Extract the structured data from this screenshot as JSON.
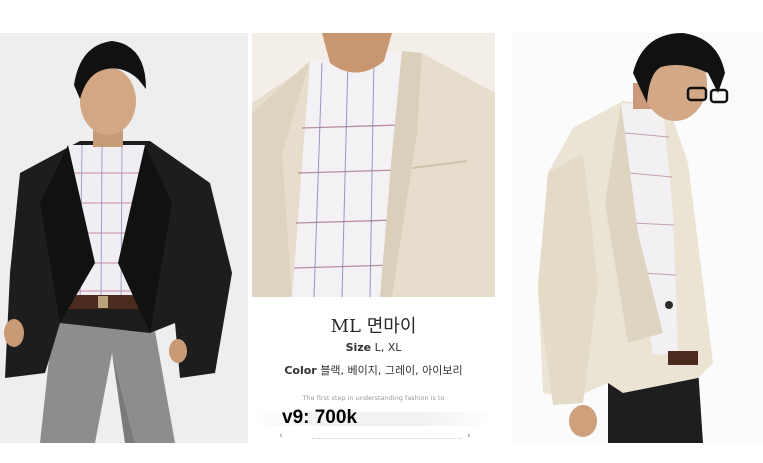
{
  "product": {
    "name": "ML 면마이",
    "size_label": "Size",
    "size_value": "L, XL",
    "color_label": "Color",
    "color_value": "블랙, 베이지, 그레이, 아이보리",
    "tagline": "The first step in understanding fashion is to",
    "price": "v9: 700k"
  },
  "navigation": {
    "prev_icon": "‹",
    "next_icon": "›"
  },
  "photos": [
    {
      "name": "black-jacket-model",
      "jacket_color": "#1b1b1b"
    },
    {
      "name": "beige-jacket-closeup",
      "jacket_color": "#e6ddcc"
    },
    {
      "name": "beige-jacket-side",
      "jacket_color": "#ebe3d4"
    }
  ]
}
